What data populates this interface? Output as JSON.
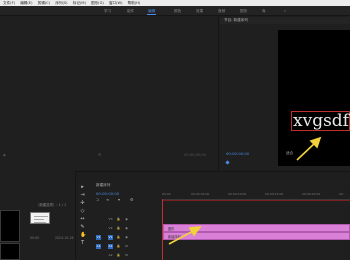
{
  "menu": {
    "items": [
      "文件(F)",
      "编辑(E)",
      "剪辑(C)",
      "序列(S)",
      "标记(M)",
      "图形(G)",
      "窗口(W)",
      "帮助(H)"
    ]
  },
  "workspace": {
    "tabs": [
      "学习",
      "组件",
      "编辑",
      "颜色",
      "效果",
      "音频",
      "图形",
      "库"
    ],
    "active_index": 2,
    "accent": "#4d8be8"
  },
  "program_monitor": {
    "title": "节目: 新建序列",
    "timecode": "00:00:00:00",
    "fit_label": "适合",
    "title_text": "xvgsdf"
  },
  "source_monitor": {
    "zero_tc": "00;00;00;00"
  },
  "project": {
    "label": "（新建选项）: 1 / 1",
    "meta_left": "00:00",
    "meta_right": "2024-10-26"
  },
  "timeline": {
    "name": "新建序列",
    "timecode": "00:00:00:00",
    "ruler": [
      "00:00",
      "00:00:05:00",
      "00:00:10:00",
      "00:00:15:00",
      "00:00:20:00",
      "00:"
    ],
    "tracks": [
      {
        "label": "V3"
      },
      {
        "label": "V2"
      },
      {
        "label": "V1"
      },
      {
        "label": "A1"
      },
      {
        "label": "A2"
      },
      {
        "label": "A3"
      }
    ],
    "clips": [
      {
        "name": "图形"
      },
      {
        "name": "新建序列"
      }
    ],
    "clip_color": "#d981d6",
    "playhead_color": "#c03030"
  },
  "annotation_color": "#f2d23a"
}
